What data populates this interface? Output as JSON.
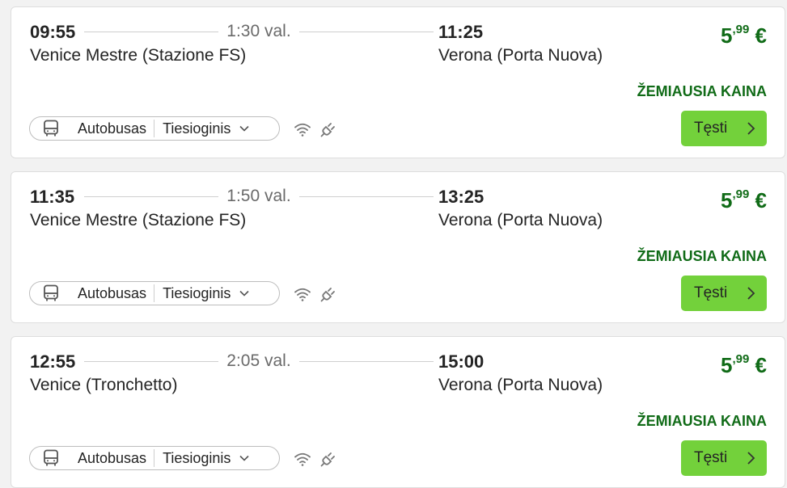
{
  "trips": [
    {
      "departure_time": "09:55",
      "duration": "1:30 val.",
      "arrival_time": "11:25",
      "departure_station": "Venice Mestre (Stazione FS)",
      "arrival_station": "Verona (Porta Nuova)",
      "price_main": "5",
      "price_cents": ",99",
      "currency": "€",
      "badge": "ŽEMIAUSIA KAINA",
      "transport_type": "Autobusas",
      "connection": "Tiesioginis",
      "button_label": "Tęsti"
    },
    {
      "departure_time": "11:35",
      "duration": "1:50 val.",
      "arrival_time": "13:25",
      "departure_station": "Venice Mestre (Stazione FS)",
      "arrival_station": "Verona (Porta Nuova)",
      "price_main": "5",
      "price_cents": ",99",
      "currency": "€",
      "badge": "ŽEMIAUSIA KAINA",
      "transport_type": "Autobusas",
      "connection": "Tiesioginis",
      "button_label": "Tęsti"
    },
    {
      "departure_time": "12:55",
      "duration": "2:05 val.",
      "arrival_time": "15:00",
      "departure_station": "Venice (Tronchetto)",
      "arrival_station": "Verona (Porta Nuova)",
      "price_main": "5",
      "price_cents": ",99",
      "currency": "€",
      "badge": "ŽEMIAUSIA KAINA",
      "transport_type": "Autobusas",
      "connection": "Tiesioginis",
      "button_label": "Tęsti"
    }
  ],
  "icons": {
    "transport": "bus-icon",
    "dropdown": "chevron-down-icon",
    "amenity_1": "wifi-icon",
    "amenity_2": "power-plug-icon",
    "button": "chevron-right-icon"
  },
  "colors": {
    "price": "#106b17",
    "button": "#73d13b",
    "card_border": "#dedede"
  }
}
